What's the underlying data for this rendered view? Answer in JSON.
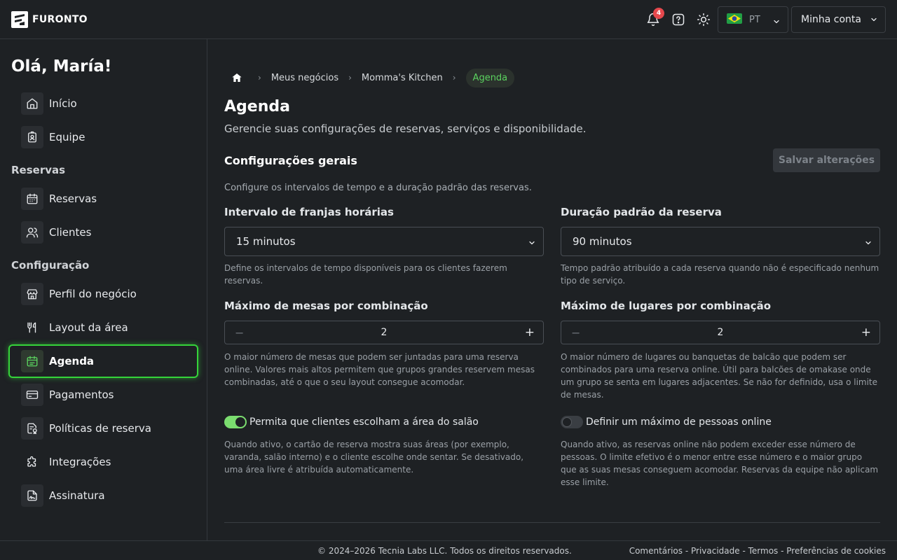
{
  "brand": {
    "name": "FURONTO"
  },
  "topbar": {
    "notifications_count": "4",
    "language_code": "PT",
    "account_label": "Minha conta",
    "icons": [
      "bell-icon",
      "help-icon",
      "sun-icon",
      "brazil-flag-icon",
      "chevron-down-icon"
    ]
  },
  "sidebar": {
    "greeting": "Olá, María!",
    "sections": {
      "reservas": "Reservas",
      "configuracao": "Configuração"
    },
    "items": [
      {
        "label": "Início",
        "icon": "home-icon"
      },
      {
        "label": "Equipe",
        "icon": "badge-icon"
      },
      {
        "label": "Reservas",
        "icon": "calendar-icon"
      },
      {
        "label": "Clientes",
        "icon": "users-icon"
      },
      {
        "label": "Perfil do negócio",
        "icon": "store-icon"
      },
      {
        "label": "Layout da área",
        "icon": "utensils-icon"
      },
      {
        "label": "Agenda",
        "icon": "calendar-edit-icon",
        "active": true
      },
      {
        "label": "Pagamentos",
        "icon": "card-icon"
      },
      {
        "label": "Políticas de reserva",
        "icon": "policy-icon"
      },
      {
        "label": "Integrações",
        "icon": "puzzle-icon"
      },
      {
        "label": "Assinatura",
        "icon": "signature-icon"
      }
    ]
  },
  "breadcrumb": {
    "home_icon": "home-icon",
    "items": [
      "Meus negócios",
      "Momma's Kitchen",
      "Agenda"
    ]
  },
  "page": {
    "title": "Agenda",
    "subtitle": "Gerencie suas configurações de reservas, serviços e disponibilidade.",
    "section_title": "Configurações gerais",
    "save_label": "Salvar alterações",
    "section_desc": "Configure os intervalos de tempo e a duração padrão das reservas."
  },
  "fields": {
    "interval": {
      "label": "Intervalo de franjas horárias",
      "value": "15 minutos",
      "help": "Define os intervalos de tempo disponíveis para os clientes fazerem reservas."
    },
    "duration": {
      "label": "Duração padrão da reserva",
      "value": "90 minutos",
      "help": "Tempo padrão atribuído a cada reserva quando não é especificado nenhum tipo de serviço."
    },
    "max_tables": {
      "label": "Máximo de mesas por combinação",
      "value": "2",
      "minus": "−",
      "plus": "+",
      "help": "O maior número de mesas que podem ser juntadas para uma reserva online. Valores mais altos permitem que grupos grandes reservem mesas combinadas, até o que o seu layout consegue acomodar."
    },
    "max_seats": {
      "label": "Máximo de lugares por combinação",
      "value": "2",
      "minus": "−",
      "plus": "+",
      "help": "O maior número de lugares ou banquetas de balcão que podem ser combinados para uma reserva online. Útil para balcões de omakase onde um grupo se senta em lugares adjacentes. Se não for definido, usa o limite de mesas."
    },
    "choose_area": {
      "label": "Permita que clientes escolham a área do salão",
      "on": true,
      "help": "Quando ativo, o cartão de reserva mostra suas áreas (por exemplo, varanda, salão interno) e o cliente escolhe onde sentar. Se desativado, uma área livre é atribuída automaticamente."
    },
    "max_people": {
      "label": "Definir um máximo de pessoas online",
      "on": false,
      "help": "Quando ativo, as reservas online não podem exceder esse número de pessoas. O limite efetivo é o menor entre esse número e o maior grupo que as suas mesas conseguem acomodar. Reservas da equipe não aplicam esse limite."
    }
  },
  "footer": {
    "copyright": "© 2024–2026 Tecnia Labs LLC. Todos os direitos reservados.",
    "links": [
      "Comentários",
      "Privacidade",
      "Termos",
      "Preferências de cookies"
    ],
    "separator": " - "
  },
  "colors": {
    "background": "#1e2124",
    "accent": "#35d43a",
    "toggle_on": "#7bdd6f",
    "badge": "#e5484d"
  }
}
